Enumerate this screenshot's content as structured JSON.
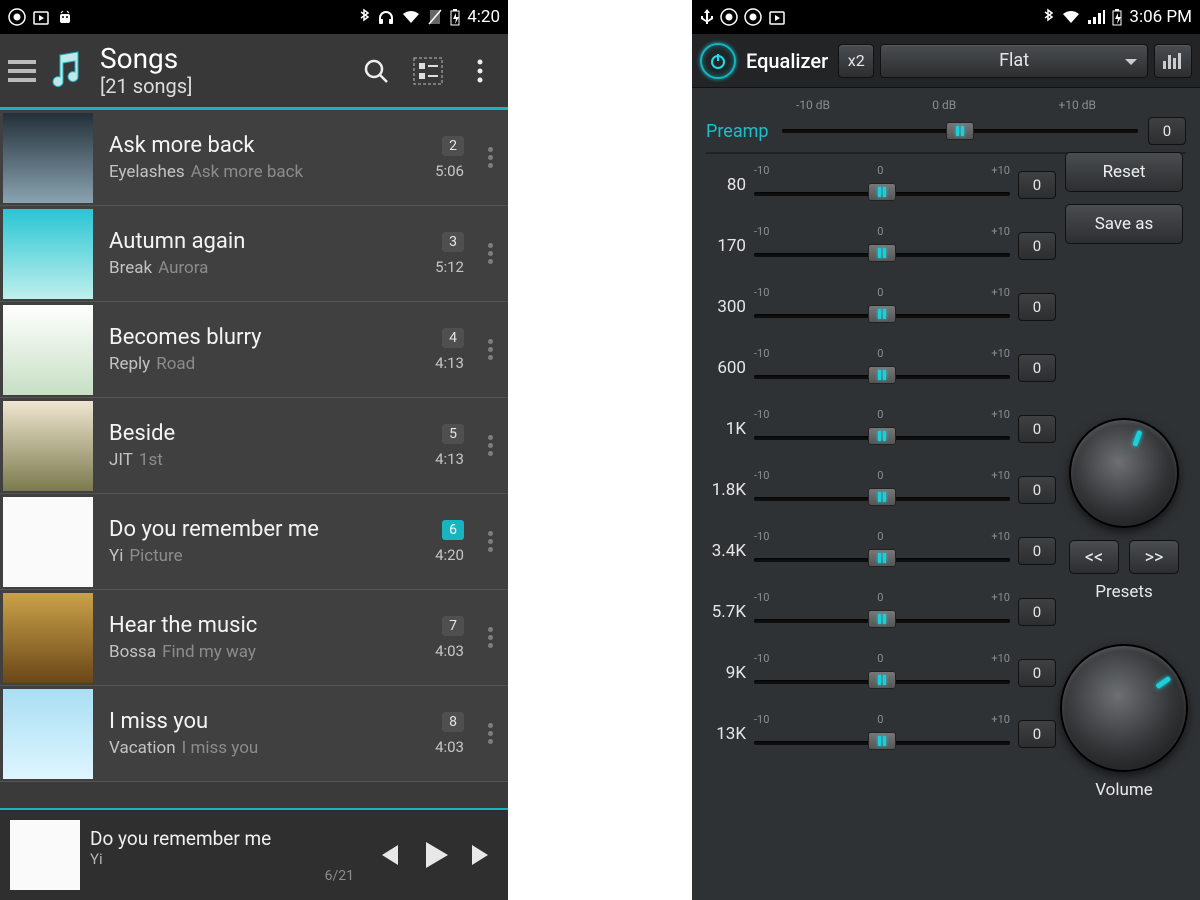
{
  "left": {
    "status": {
      "time": "4:20",
      "icons": [
        "camera",
        "playstore",
        "android",
        "bluetooth",
        "headphones",
        "wifi",
        "no-sim",
        "battery-charging"
      ]
    },
    "header": {
      "title": "Songs",
      "subtitle": "[21 songs]"
    },
    "songs": [
      {
        "title": "Ask more back",
        "artist": "Eyelashes",
        "album": "Ask more back",
        "track": "2",
        "dur": "5:06",
        "accent": false
      },
      {
        "title": "Autumn again",
        "artist": "Break",
        "album": "Aurora",
        "track": "3",
        "dur": "5:12",
        "accent": false
      },
      {
        "title": "Becomes blurry",
        "artist": "Reply",
        "album": "Road",
        "track": "4",
        "dur": "4:13",
        "accent": false
      },
      {
        "title": "Beside",
        "artist": "JIT",
        "album": "1st",
        "track": "5",
        "dur": "4:13",
        "accent": false
      },
      {
        "title": "Do you remember me",
        "artist": "Yi",
        "album": "Picture",
        "track": "6",
        "dur": "4:20",
        "accent": true
      },
      {
        "title": "Hear the music",
        "artist": "Bossa",
        "album": "Find my way",
        "track": "7",
        "dur": "4:03",
        "accent": false
      },
      {
        "title": "I miss you",
        "artist": "Vacation",
        "album": "I miss you",
        "track": "8",
        "dur": "4:03",
        "accent": false
      }
    ],
    "now": {
      "title": "Do you remember me",
      "artist": "Yi",
      "queue": "6/21"
    }
  },
  "right": {
    "status": {
      "time": "3:06 PM",
      "icons": [
        "usb",
        "camera",
        "camera",
        "playstore",
        "bluetooth",
        "wifi",
        "signal",
        "battery-charging"
      ]
    },
    "header": {
      "title": "Equalizer",
      "multiplier": "x2",
      "preset": "Flat"
    },
    "dbscale": {
      "low": "-10 dB",
      "mid": "0 dB",
      "high": "+10 dB"
    },
    "preamp": {
      "label": "Preamp",
      "value": "0",
      "pos": 50
    },
    "band_marks": {
      "low": "-10",
      "mid": "0",
      "high": "+10"
    },
    "bands": [
      {
        "freq": "80",
        "value": "0",
        "pos": 50
      },
      {
        "freq": "170",
        "value": "0",
        "pos": 50
      },
      {
        "freq": "300",
        "value": "0",
        "pos": 50
      },
      {
        "freq": "600",
        "value": "0",
        "pos": 50
      },
      {
        "freq": "1K",
        "value": "0",
        "pos": 50
      },
      {
        "freq": "1.8K",
        "value": "0",
        "pos": 50
      },
      {
        "freq": "3.4K",
        "value": "0",
        "pos": 50
      },
      {
        "freq": "5.7K",
        "value": "0",
        "pos": 50
      },
      {
        "freq": "9K",
        "value": "0",
        "pos": 50
      },
      {
        "freq": "13K",
        "value": "0",
        "pos": 50
      }
    ],
    "buttons": {
      "reset": "Reset",
      "saveas": "Save as",
      "prev": "<<",
      "next": ">>"
    },
    "labels": {
      "presets": "Presets",
      "volume": "Volume"
    },
    "knob_angles": {
      "balance": 20,
      "volume": 55
    }
  },
  "accent": "#18b5c0"
}
